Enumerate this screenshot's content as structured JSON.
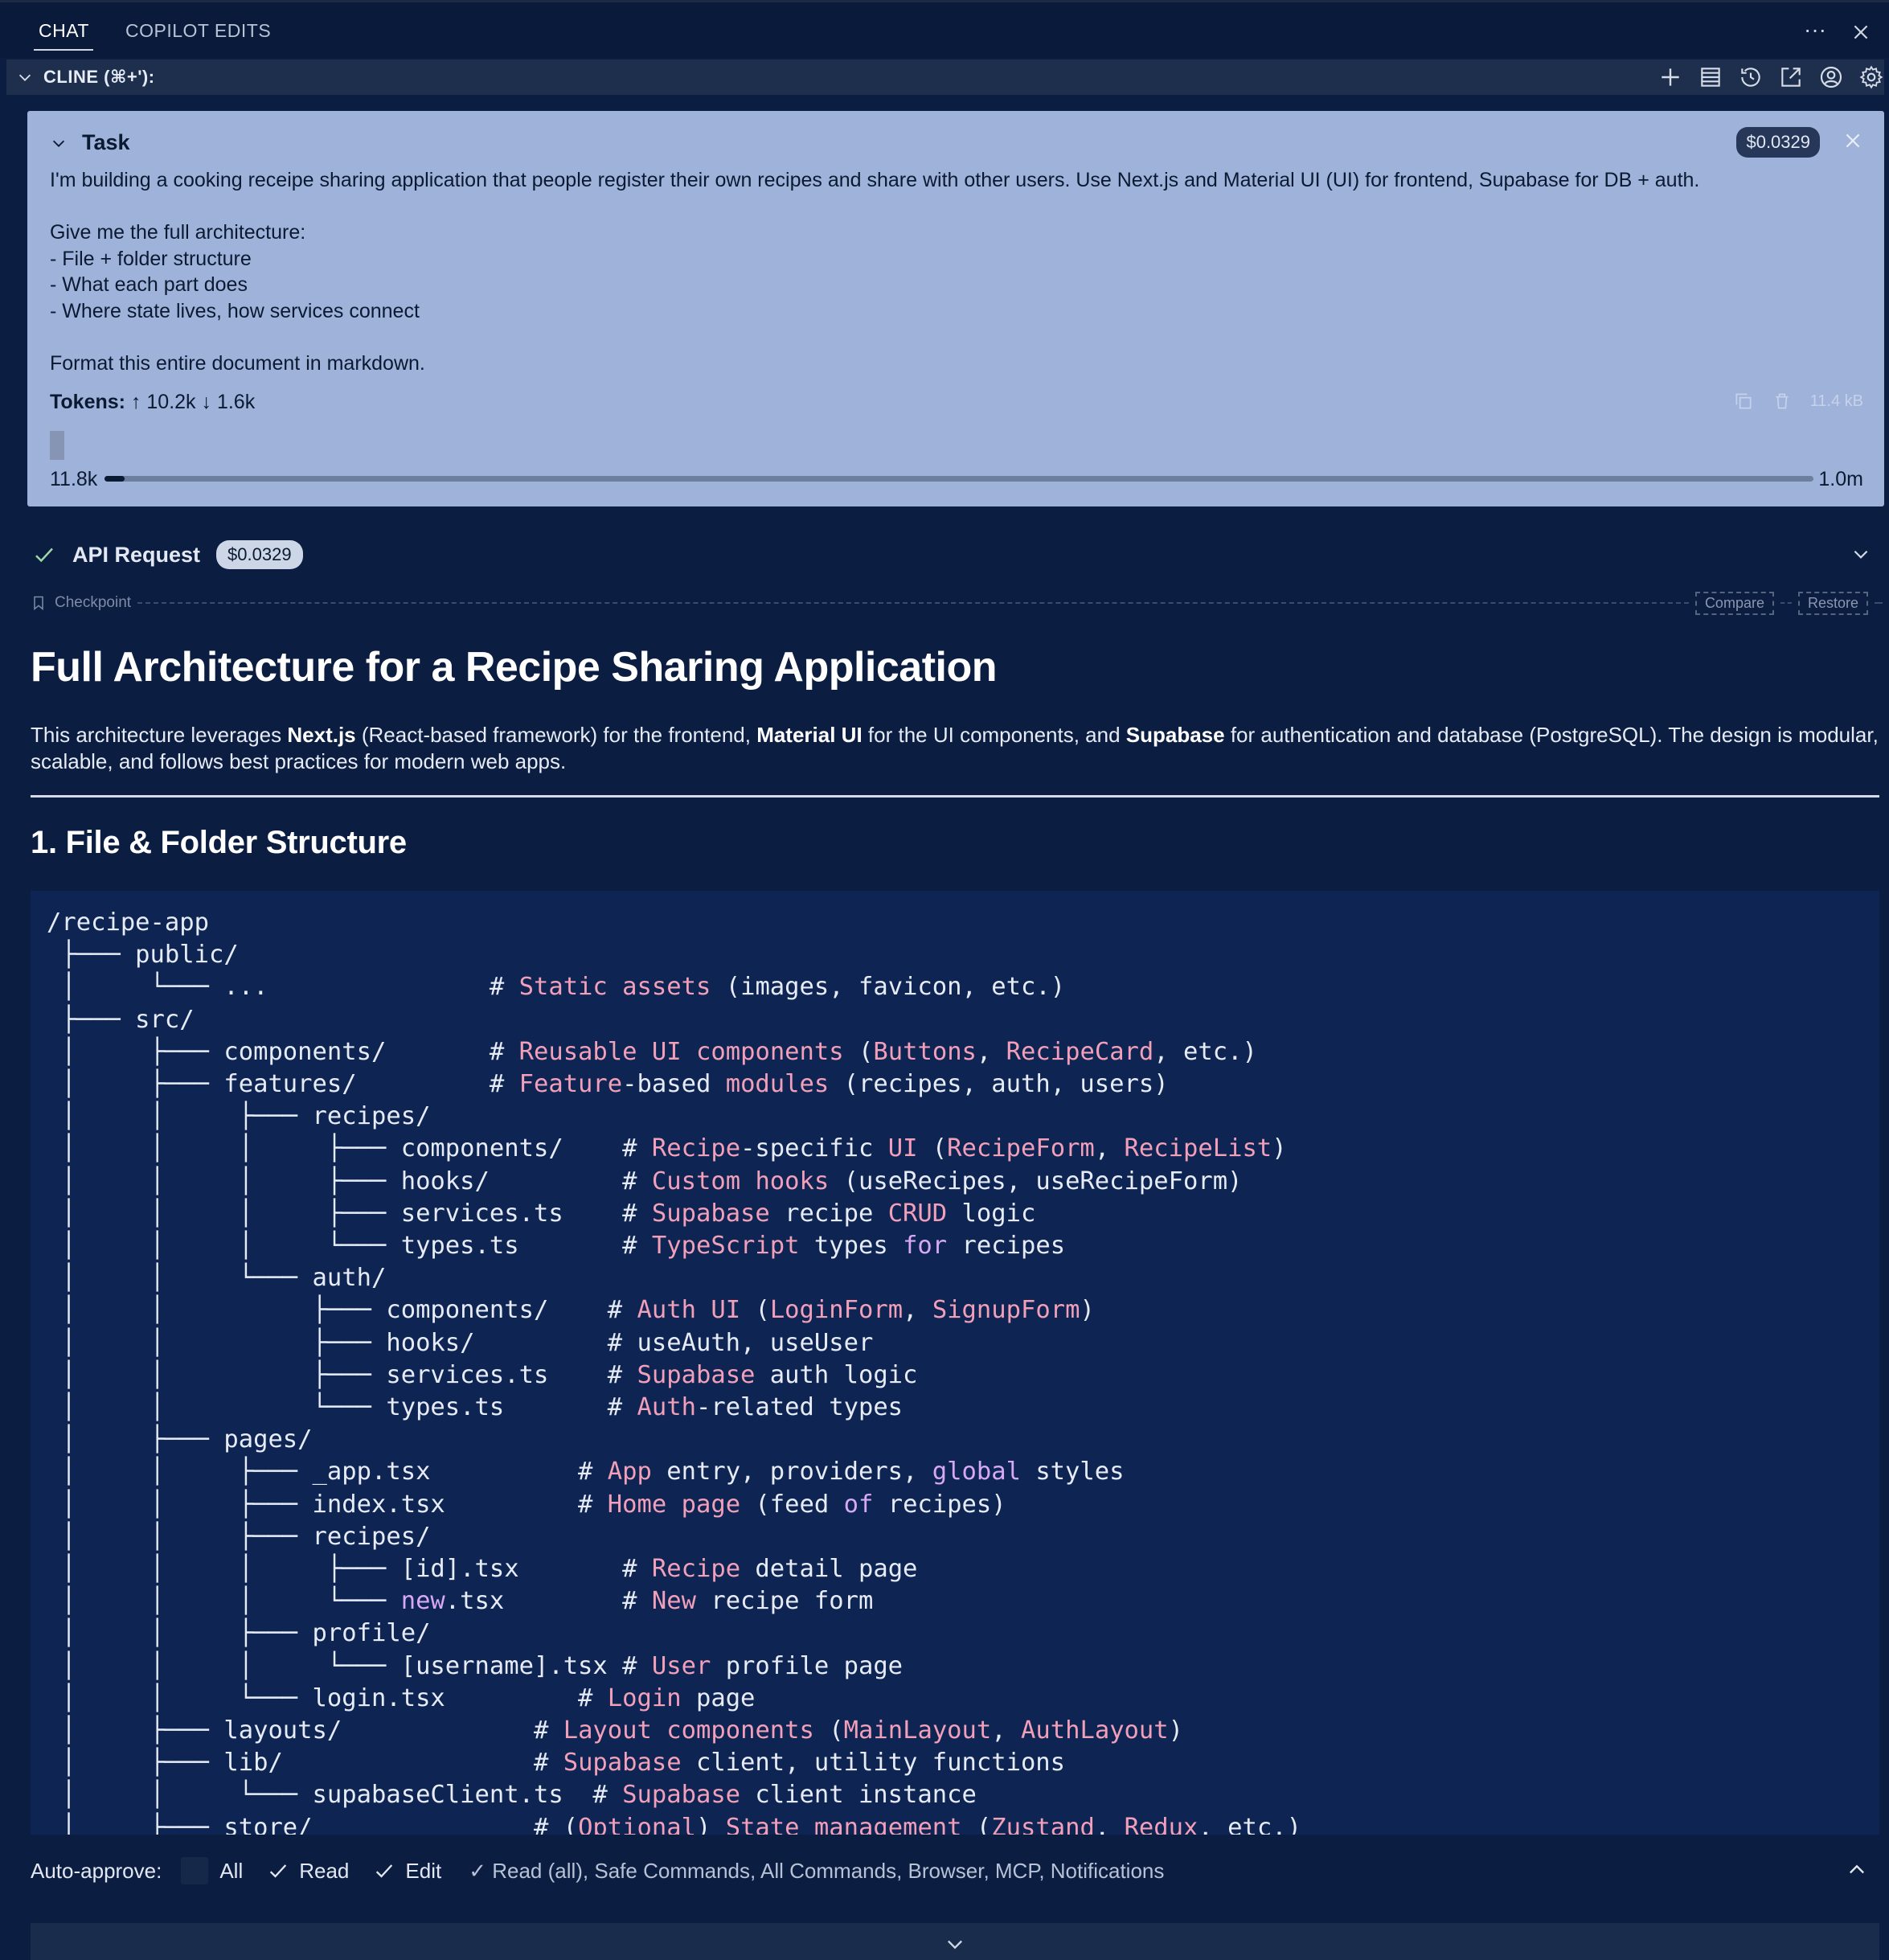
{
  "tabs": [
    {
      "label": "CHAT",
      "active": true
    },
    {
      "label": "COPILOT EDITS",
      "active": false
    }
  ],
  "top_actions": {
    "more": "···"
  },
  "cline_header": {
    "title": "CLINE (⌘+'):"
  },
  "task": {
    "label": "Task",
    "cost": "$0.0329",
    "lines": [
      "I'm building a cooking receipe sharing application that people register their own recipes and share with other users. Use Next.js and Material UI (UI) for frontend, Supabase for DB + auth.",
      "",
      "Give me the full architecture:",
      "- File + folder structure",
      "- What each part does",
      "- Where state lives, how services connect",
      "",
      "Format this entire document in markdown."
    ],
    "tokens_label": "Tokens:",
    "tokens_up": "↑ 10.2k",
    "tokens_down": "↓ 1.6k",
    "size": "11.4 kB",
    "context_used": "11.8k",
    "context_max": "1.0m",
    "context_fraction": 0.0118
  },
  "api_request": {
    "label": "API Request",
    "cost": "$0.0329"
  },
  "checkpoint": {
    "label": "Checkpoint",
    "compare": "Compare",
    "restore": "Restore"
  },
  "doc": {
    "title": "Full Architecture for a Recipe Sharing Application",
    "intro": [
      {
        "t": "This architecture leverages ",
        "b": false
      },
      {
        "t": "Next.js",
        "b": true
      },
      {
        "t": " (React-based framework) for the frontend, ",
        "b": false
      },
      {
        "t": "Material UI",
        "b": true
      },
      {
        "t": " for the UI components, and ",
        "b": false
      },
      {
        "t": "Supabase",
        "b": true
      },
      {
        "t": " for authentication and database (PostgreSQL). The design is modular, scalable, and follows best practices for modern web apps.",
        "b": false
      }
    ],
    "section1": "1. File & Folder Structure",
    "code_lines": [
      [
        [
          "/recipe-app",
          ""
        ]
      ],
      [
        [
          " ├─── public/",
          ""
        ]
      ],
      [
        [
          " │     └─── ...               # ",
          ""
        ],
        [
          "Static",
          "k"
        ],
        [
          " ",
          ""
        ],
        [
          "assets",
          "k"
        ],
        [
          " (images, favicon, etc.)",
          ""
        ]
      ],
      [
        [
          " ├─── src/",
          ""
        ]
      ],
      [
        [
          " │     ├─── components/       # ",
          ""
        ],
        [
          "Reusable",
          "k"
        ],
        [
          " ",
          ""
        ],
        [
          "UI",
          "k"
        ],
        [
          " ",
          ""
        ],
        [
          "components",
          "k"
        ],
        [
          " (",
          ""
        ],
        [
          "Buttons",
          "k"
        ],
        [
          ", ",
          ""
        ],
        [
          "RecipeCard",
          "k"
        ],
        [
          ", etc.)",
          ""
        ]
      ],
      [
        [
          " │     ├─── features/         # ",
          ""
        ],
        [
          "Feature",
          "k"
        ],
        [
          "-based ",
          ""
        ],
        [
          "modules",
          "k"
        ],
        [
          " (recipes, auth, users)",
          ""
        ]
      ],
      [
        [
          " │     │     ├─── recipes/",
          ""
        ]
      ],
      [
        [
          " │     │     │     ├─── components/    # ",
          ""
        ],
        [
          "Recipe",
          "k"
        ],
        [
          "-specific ",
          ""
        ],
        [
          "UI",
          "k"
        ],
        [
          " (",
          ""
        ],
        [
          "RecipeForm",
          "k"
        ],
        [
          ", ",
          ""
        ],
        [
          "RecipeList",
          "k"
        ],
        [
          ")",
          ""
        ]
      ],
      [
        [
          " │     │     │     ├─── hooks/         # ",
          ""
        ],
        [
          "Custom",
          "k"
        ],
        [
          " ",
          ""
        ],
        [
          "hooks",
          "k"
        ],
        [
          " (useRecipes, useRecipeForm)",
          ""
        ]
      ],
      [
        [
          " │     │     │     ├─── services.ts    # ",
          ""
        ],
        [
          "Supabase",
          "k"
        ],
        [
          " recipe ",
          ""
        ],
        [
          "CRUD",
          "k"
        ],
        [
          " logic",
          ""
        ]
      ],
      [
        [
          " │     │     │     └─── types.ts       # ",
          ""
        ],
        [
          "TypeScript",
          "k"
        ],
        [
          " types ",
          ""
        ],
        [
          "for",
          "kw"
        ],
        [
          " recipes",
          ""
        ]
      ],
      [
        [
          " │     │     └─── auth/",
          ""
        ]
      ],
      [
        [
          " │     │          ├─── components/    # ",
          ""
        ],
        [
          "Auth",
          "k"
        ],
        [
          " ",
          ""
        ],
        [
          "UI",
          "k"
        ],
        [
          " (",
          ""
        ],
        [
          "LoginForm",
          "k"
        ],
        [
          ", ",
          ""
        ],
        [
          "SignupForm",
          "k"
        ],
        [
          ")",
          ""
        ]
      ],
      [
        [
          " │     │          ├─── hooks/         # useAuth, useUser",
          ""
        ]
      ],
      [
        [
          " │     │          ├─── services.ts    # ",
          ""
        ],
        [
          "Supabase",
          "k"
        ],
        [
          " auth logic",
          ""
        ]
      ],
      [
        [
          " │     │          └─── types.ts       # ",
          ""
        ],
        [
          "Auth",
          "k"
        ],
        [
          "-related types",
          ""
        ]
      ],
      [
        [
          " │     ├─── pages/",
          ""
        ]
      ],
      [
        [
          " │     │     ├─── _app.tsx          # ",
          ""
        ],
        [
          "App",
          "k"
        ],
        [
          " entry, providers, ",
          ""
        ],
        [
          "global",
          "kw"
        ],
        [
          " styles",
          ""
        ]
      ],
      [
        [
          " │     │     ├─── index.tsx         # ",
          ""
        ],
        [
          "Home",
          "k"
        ],
        [
          " ",
          ""
        ],
        [
          "page",
          "k"
        ],
        [
          " (feed ",
          ""
        ],
        [
          "of",
          "kw"
        ],
        [
          " recipes)",
          ""
        ]
      ],
      [
        [
          " │     │     ├─── recipes/",
          ""
        ]
      ],
      [
        [
          " │     │     │     ├─── [id].tsx       # ",
          ""
        ],
        [
          "Recipe",
          "k"
        ],
        [
          " detail page",
          ""
        ]
      ],
      [
        [
          " │     │     │     └─── ",
          ""
        ],
        [
          "new",
          "kw"
        ],
        [
          ".tsx        # ",
          ""
        ],
        [
          "New",
          "k"
        ],
        [
          " recipe form",
          ""
        ]
      ],
      [
        [
          " │     │     ├─── profile/",
          ""
        ]
      ],
      [
        [
          " │     │     │     └─── [username].tsx # ",
          ""
        ],
        [
          "User",
          "k"
        ],
        [
          " profile page",
          ""
        ]
      ],
      [
        [
          " │     │     └─── login.tsx         # ",
          ""
        ],
        [
          "Login",
          "k"
        ],
        [
          " page",
          ""
        ]
      ],
      [
        [
          " │     ├─── layouts/             # ",
          ""
        ],
        [
          "Layout",
          "k"
        ],
        [
          " ",
          ""
        ],
        [
          "components",
          "k"
        ],
        [
          " (",
          ""
        ],
        [
          "MainLayout",
          "k"
        ],
        [
          ", ",
          ""
        ],
        [
          "AuthLayout",
          "k"
        ],
        [
          ")",
          ""
        ]
      ],
      [
        [
          " │     ├─── lib/                 # ",
          ""
        ],
        [
          "Supabase",
          "k"
        ],
        [
          " client, utility functions",
          ""
        ]
      ],
      [
        [
          " │     │     └─── supabaseClient.ts  # ",
          ""
        ],
        [
          "Supabase",
          "k"
        ],
        [
          " client instance",
          ""
        ]
      ],
      [
        [
          " │     ├─── store/               # (",
          ""
        ],
        [
          "Optional",
          "k"
        ],
        [
          ") ",
          ""
        ],
        [
          "State",
          "k"
        ],
        [
          " ",
          ""
        ],
        [
          "management",
          "k"
        ],
        [
          " (",
          ""
        ],
        [
          "Zustand",
          "k"
        ],
        [
          ", ",
          ""
        ],
        [
          "Redux",
          "k"
        ],
        [
          ", etc.)",
          ""
        ]
      ]
    ]
  },
  "auto_approve": {
    "label": "Auto-approve:",
    "all": "All",
    "read": "Read",
    "edit": "Edit",
    "summary": "✓ Read (all), Safe Commands, All Commands, Browser, MCP, Notifications"
  },
  "icons": {
    "close": "close-icon",
    "chevron": "chevron-down-icon",
    "plus": "plus-icon",
    "history": "history-icon",
    "settings": "gear-icon"
  }
}
